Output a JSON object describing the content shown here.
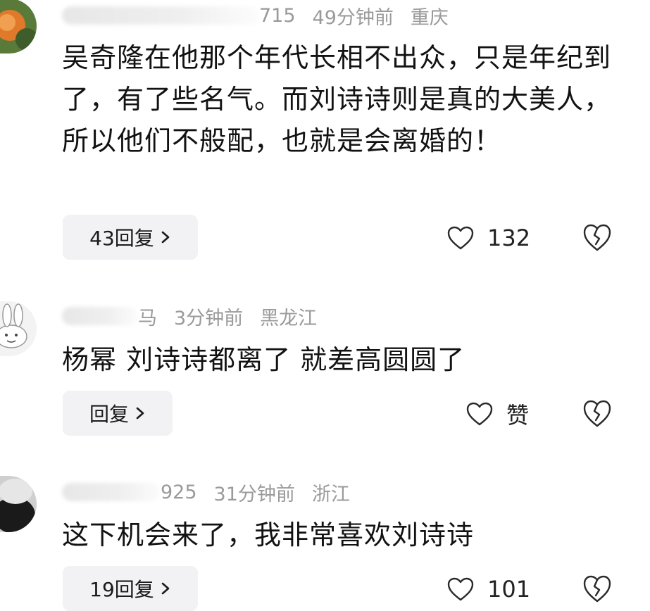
{
  "comments": [
    {
      "user_suffix": "715",
      "time": "49分钟前",
      "location": "重庆",
      "text": "吴奇隆在他那个年代长相不出众，只是年纪到了，有了些名气。而刘诗诗则是真的大美人，所以他们不般配，也就是会离婚的！",
      "reply_label": "43回复",
      "like_label": "132"
    },
    {
      "user_suffix": "马",
      "time": "3分钟前",
      "location": "黑龙江",
      "text": "杨幂 刘诗诗都离了 就差高圆圆了",
      "reply_label": "回复",
      "like_label": "赞"
    },
    {
      "user_suffix": "925",
      "time": "31分钟前",
      "location": "浙江",
      "text": "这下机会来了，我非常喜欢刘诗诗",
      "reply_label": "19回复",
      "like_label": "101"
    }
  ]
}
